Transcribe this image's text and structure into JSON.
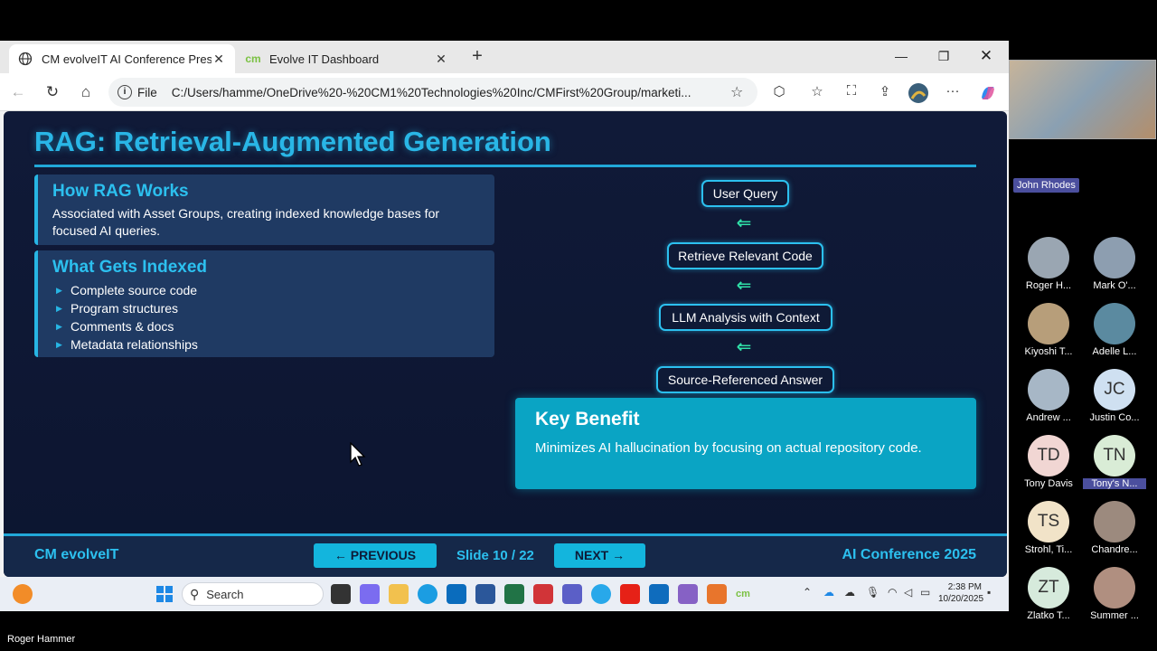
{
  "browser": {
    "tabs": [
      {
        "title": "CM evolveIT AI Conference Preser",
        "active": true
      },
      {
        "title": "Evolve IT Dashboard",
        "active": false,
        "badge": "cm"
      }
    ],
    "address": {
      "scheme_label": "File",
      "url": "C:/Users/hamme/OneDrive%20-%20CM1%20Technologies%20Inc/CMFirst%20Group/marketi..."
    }
  },
  "slide": {
    "title": "RAG: Retrieval-Augmented Generation",
    "card1": {
      "heading": "How RAG Works",
      "body": "Associated with Asset Groups, creating indexed knowledge bases for focused AI queries."
    },
    "card2": {
      "heading": "What Gets Indexed",
      "items": [
        "Complete source code",
        "Program structures",
        "Comments & docs",
        "Metadata relationships"
      ]
    },
    "flow": [
      "User Query",
      "Retrieve Relevant Code",
      "LLM Analysis with Context",
      "Source-Referenced Answer"
    ],
    "flow_arrow": "⇐",
    "benefit": {
      "heading": "Key Benefit",
      "body": "Minimizes AI hallucination by focusing on actual repository code."
    },
    "footer": {
      "brand": "CM evolveIT",
      "previous": "← PREVIOUS",
      "counter": "Slide 10 / 22",
      "next": "NEXT →",
      "event": "AI Conference 2025"
    }
  },
  "taskbar": {
    "search_label": "Search",
    "time": "2:38 PM",
    "date": "10/20/2025"
  },
  "meeting": {
    "presenter": "Roger Hammer",
    "speaker_tag": "John Rhodes",
    "participants": [
      {
        "initials": "",
        "name": "Roger H...",
        "color": "#9aa6b2"
      },
      {
        "initials": "",
        "name": "Mark O'...",
        "color": "#8d9eb0"
      },
      {
        "initials": "",
        "name": "Kiyoshi T...",
        "color": "#b79e7a"
      },
      {
        "initials": "",
        "name": "Adelle L...",
        "color": "#5b8aa0"
      },
      {
        "initials": "",
        "name": "Andrew ...",
        "color": "#a7b7c6"
      },
      {
        "initials": "JC",
        "name": "Justin Co...",
        "color": "#cfe0f1"
      },
      {
        "initials": "TD",
        "name": "Tony Davis",
        "color": "#f1d6d3"
      },
      {
        "initials": "TN",
        "name": "Tony's N...",
        "color": "#d9ecd6"
      },
      {
        "initials": "TS",
        "name": "Strohl, Ti...",
        "color": "#f1e3c8"
      },
      {
        "initials": "",
        "name": "Chandre...",
        "color": "#9c8a7e"
      },
      {
        "initials": "ZT",
        "name": "Zlatko T...",
        "color": "#d6eadc"
      },
      {
        "initials": "",
        "name": "Summer ...",
        "color": "#b08f80"
      }
    ]
  }
}
